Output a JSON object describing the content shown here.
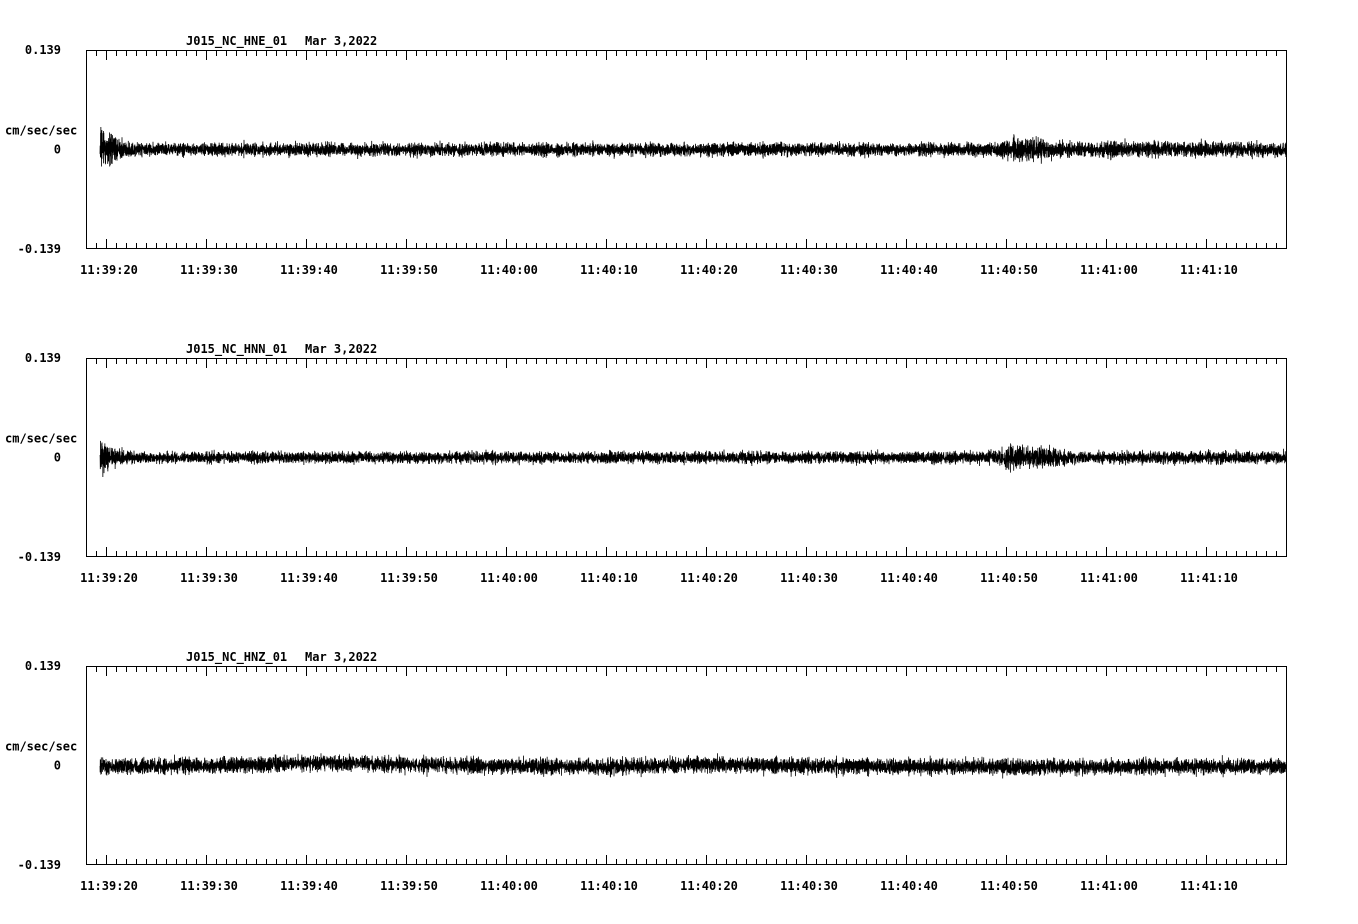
{
  "chart_data": [
    {
      "type": "line",
      "title": "J015_NC_HNE_01",
      "date": "Mar 3,2022",
      "ylabel": "cm/sec/sec",
      "ytick_labels": [
        "0.139",
        "0",
        "-0.139"
      ],
      "ylim": [
        -0.139,
        0.139
      ],
      "xlim_seconds": [
        -2.0,
        58.0
      ],
      "x_tick_labels": [
        "11:39:20",
        "11:39:30",
        "11:39:40",
        "11:39:50",
        "11:40:00",
        "11:40:10",
        "11:40:20",
        "11:40:30",
        "11:40:40",
        "11:40:50",
        "11:41:00",
        "11:41:10"
      ],
      "x_tick_seconds": [
        0,
        10,
        20,
        30,
        40,
        50,
        60,
        70,
        80,
        90,
        100,
        110
      ],
      "signal_start_seconds": -0.6,
      "noise_amplitude": 0.014,
      "envelope": [
        {
          "t": -0.6,
          "peak": 0.055
        },
        {
          "t": 1.5,
          "peak": 0.025
        },
        {
          "t": 3.0,
          "peak": 0.016
        },
        {
          "t": 89.0,
          "peak": 0.016
        },
        {
          "t": 90.5,
          "peak": 0.03
        },
        {
          "t": 93.0,
          "peak": 0.025
        },
        {
          "t": 97.0,
          "peak": 0.02
        },
        {
          "t": 118.0,
          "peak": 0.018
        }
      ],
      "baseline_trend": []
    },
    {
      "type": "line",
      "title": "J015_NC_HNN_01",
      "date": "Mar 3,2022",
      "ylabel": "cm/sec/sec",
      "ytick_labels": [
        "0.139",
        "0",
        "-0.139"
      ],
      "ylim": [
        -0.139,
        0.139
      ],
      "x_tick_labels": [
        "11:39:20",
        "11:39:30",
        "11:39:40",
        "11:39:50",
        "11:40:00",
        "11:40:10",
        "11:40:20",
        "11:40:30",
        "11:40:40",
        "11:40:50",
        "11:41:00",
        "11:41:10"
      ],
      "x_tick_seconds": [
        0,
        10,
        20,
        30,
        40,
        50,
        60,
        70,
        80,
        90,
        100,
        110
      ],
      "signal_start_seconds": -0.6,
      "noise_amplitude": 0.012,
      "envelope": [
        {
          "t": -0.6,
          "peak": 0.045
        },
        {
          "t": 1.5,
          "peak": 0.02
        },
        {
          "t": 3.0,
          "peak": 0.014
        },
        {
          "t": 88.0,
          "peak": 0.015
        },
        {
          "t": 90.0,
          "peak": 0.03
        },
        {
          "t": 94.0,
          "peak": 0.025
        },
        {
          "t": 97.0,
          "peak": 0.016
        },
        {
          "t": 118.0,
          "peak": 0.016
        }
      ],
      "baseline_trend": []
    },
    {
      "type": "line",
      "title": "J015_NC_HNZ_01",
      "date": "Mar 3,2022",
      "ylabel": "cm/sec/sec",
      "ytick_labels": [
        "0.139",
        "0",
        "-0.139"
      ],
      "ylim": [
        -0.139,
        0.139
      ],
      "x_tick_labels": [
        "11:39:20",
        "11:39:30",
        "11:39:40",
        "11:39:50",
        "11:40:00",
        "11:40:10",
        "11:40:20",
        "11:40:30",
        "11:40:40",
        "11:40:50",
        "11:41:00",
        "11:41:10"
      ],
      "x_tick_seconds": [
        0,
        10,
        20,
        30,
        40,
        50,
        60,
        70,
        80,
        90,
        100,
        110
      ],
      "signal_start_seconds": -0.6,
      "noise_amplitude": 0.018,
      "envelope": [
        {
          "t": -0.6,
          "peak": 0.02
        },
        {
          "t": 118.0,
          "peak": 0.02
        }
      ],
      "baseline_trend": [
        {
          "t": -0.6,
          "value": -0.003
        },
        {
          "t": 12.0,
          "value": 0.0
        },
        {
          "t": 22.0,
          "value": 0.007
        },
        {
          "t": 30.0,
          "value": 0.002
        },
        {
          "t": 50.0,
          "value": -0.004
        },
        {
          "t": 60.0,
          "value": 0.003
        },
        {
          "t": 70.0,
          "value": -0.001
        },
        {
          "t": 90.0,
          "value": -0.004
        },
        {
          "t": 118.0,
          "value": -0.003
        }
      ]
    }
  ]
}
